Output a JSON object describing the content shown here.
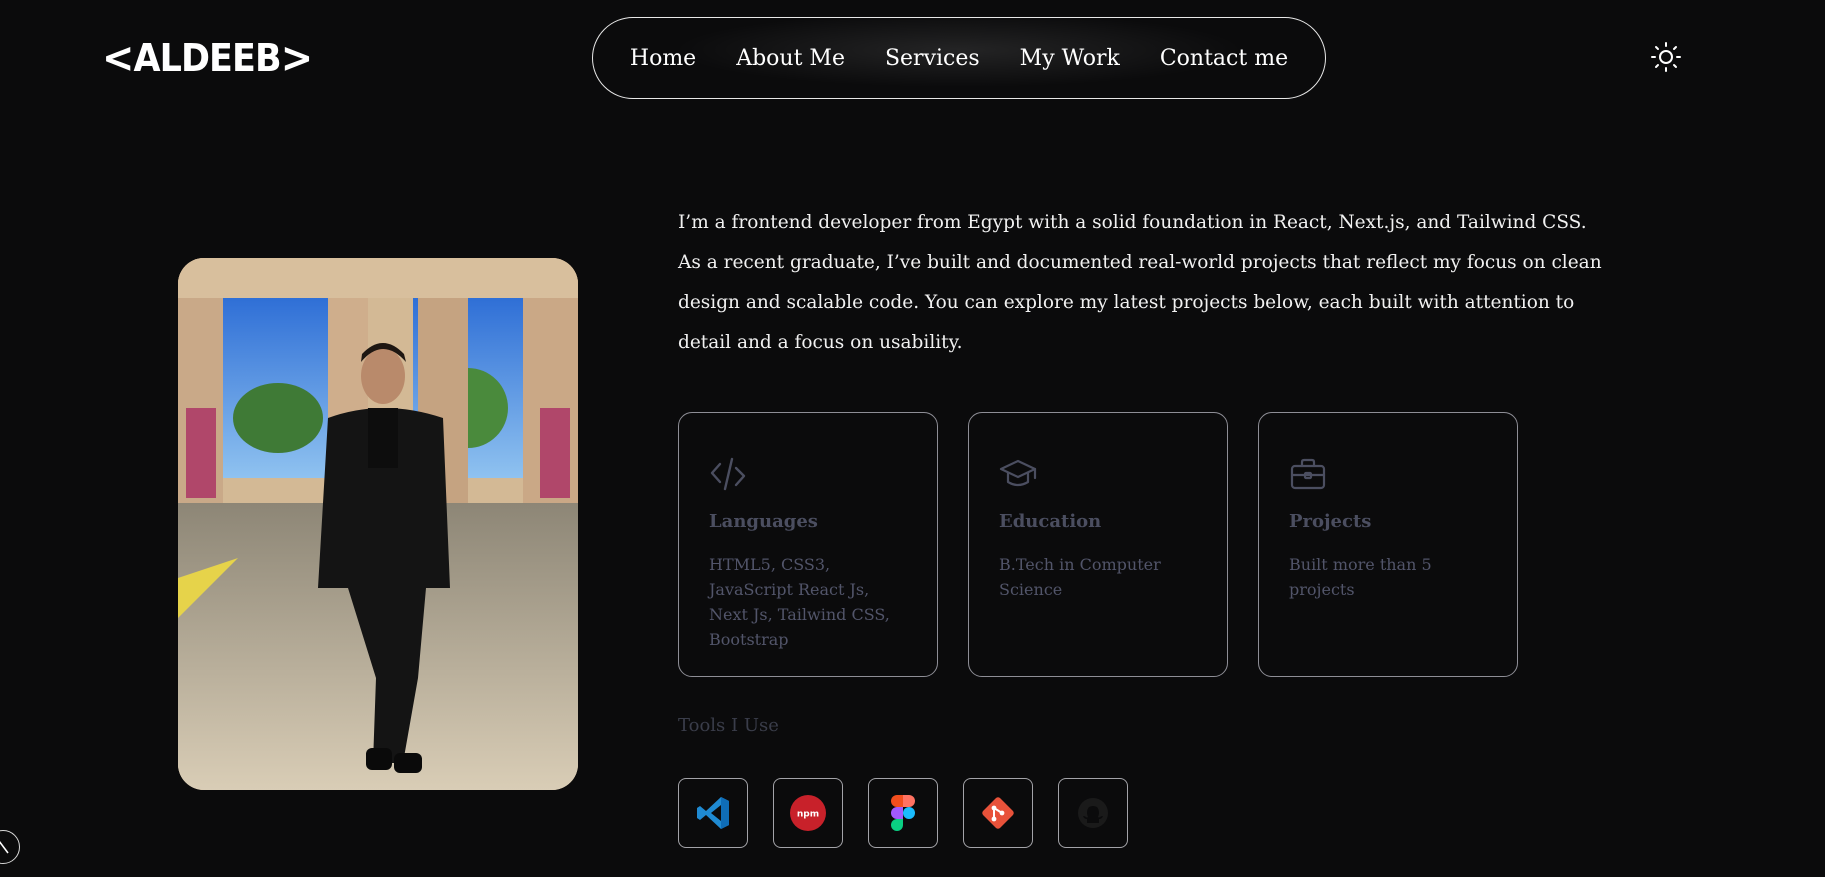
{
  "header": {
    "logo_text": "ALDEEB",
    "logo_left": "<",
    "logo_right": ">",
    "nav": [
      {
        "label": "Home"
      },
      {
        "label": "About Me"
      },
      {
        "label": "Services"
      },
      {
        "label": "My Work"
      },
      {
        "label": "Contact me"
      }
    ],
    "theme_icon": "sun-icon"
  },
  "about": {
    "intro": "I’m a frontend developer from Egypt with a solid foundation in React, Next.js, and Tailwind CSS. As a recent graduate, I’ve built and documented real-world projects that reflect my focus on clean design and scalable code. You can explore my latest projects below, each built with attention to detail and a focus on usability.",
    "cards": [
      {
        "icon": "code-icon",
        "title": "Languages",
        "text": "HTML5, CSS3, JavaScript React Js, Next Js, Tailwind CSS, Bootstrap"
      },
      {
        "icon": "graduation-cap-icon",
        "title": "Education",
        "text": "B.Tech in Computer Science"
      },
      {
        "icon": "briefcase-icon",
        "title": "Projects",
        "text": "Built more than 5 projects"
      }
    ],
    "tools_heading": "Tools I Use",
    "tools": [
      {
        "icon": "vscode-icon"
      },
      {
        "icon": "npm-icon",
        "label": "npm"
      },
      {
        "icon": "figma-icon"
      },
      {
        "icon": "git-icon"
      },
      {
        "icon": "github-icon"
      }
    ]
  },
  "colors": {
    "background": "#0b0b0c",
    "text": "#ffffff",
    "card_text": "#52556a",
    "card_border": "#8e8e96"
  }
}
